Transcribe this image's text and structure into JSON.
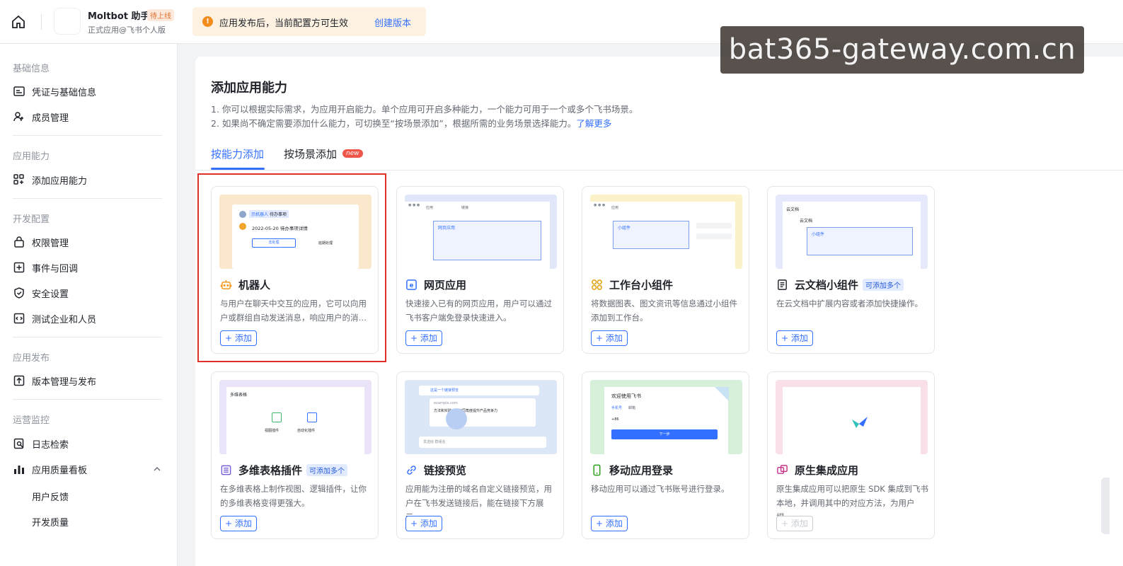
{
  "header": {
    "app_name": "Moltbot 助手",
    "app_status": "待上线",
    "app_subtitle": "正式应用@飞书个人版",
    "notice_text": "应用发布后，当前配置方可生效",
    "notice_link": "创建版本",
    "notice_icon": "!"
  },
  "watermark": "bat365-gateway.com.cn",
  "sidebar": {
    "sections": [
      {
        "title": "基础信息",
        "items": [
          "凭证与基础信息",
          "成员管理"
        ]
      },
      {
        "title": "应用能力",
        "items": [
          "添加应用能力"
        ]
      },
      {
        "title": "开发配置",
        "items": [
          "权限管理",
          "事件与回调",
          "安全设置",
          "测试企业和人员"
        ]
      },
      {
        "title": "应用发布",
        "items": [
          "版本管理与发布"
        ]
      },
      {
        "title": "运营监控",
        "items": [
          "日志检索",
          "应用质量看板"
        ],
        "subitems": [
          "用户反馈",
          "开发质量"
        ]
      }
    ]
  },
  "main": {
    "title": "添加应用能力",
    "desc1": "1. 你可以根据实际需求，为应用开启能力。单个应用可开启多种能力，一个能力可用于一个或多个飞书场景。",
    "desc2": "2. 如果尚不确定需要添加什么能力，可切换至“按场景添加”，根据所需的业务场景选择能力。",
    "desc2_link": "了解更多",
    "tabs": [
      {
        "label": "按能力添加",
        "active": true
      },
      {
        "label": "按场景添加",
        "badge": "new"
      }
    ],
    "add_label": "+ 添加",
    "multi_badge": "可添加多个",
    "cards": [
      {
        "title": "机器人",
        "desc": "与用户在聊天中交互的应用，它可以向用户或群组自动发送消息，响应用户的消…",
        "icon": "robot-icon",
        "disabled": false
      },
      {
        "title": "网页应用",
        "desc": "快速接入已有的网页应用，用户可以通过飞书客户端免登录快速进入。",
        "icon": "web-app-icon",
        "disabled": false
      },
      {
        "title": "工作台小组件",
        "desc": "将数据图表、图文资讯等信息通过小组件添加到工作台。",
        "icon": "widget-icon",
        "disabled": false
      },
      {
        "title": "云文档小组件",
        "desc": "在云文档中扩展内容或者添加快捷操作。",
        "icon": "doc-icon",
        "multi": true,
        "disabled": false
      },
      {
        "title": "多维表格插件",
        "desc": "在多维表格上制作视图、逻辑插件，让你的多维表格变得更强大。",
        "icon": "base-icon",
        "multi": true,
        "disabled": false
      },
      {
        "title": "链接预览",
        "desc": "应用能为注册的域名自定义链接预览，用户在飞书发送链接后，能在链接下方展示…",
        "icon": "link-icon",
        "disabled": false
      },
      {
        "title": "移动应用登录",
        "desc": "移动应用可以通过飞书账号进行登录。",
        "icon": "mobile-icon",
        "disabled": false
      },
      {
        "title": "原生集成应用",
        "desc": "原生集成应用可以把原生 SDK 集成到飞书本地，并调用其中的对应方法，为用户提…",
        "icon": "native-icon",
        "disabled": true
      }
    ],
    "thumbs": {
      "bot_tag": "示机器人",
      "bot_tag2": "待办事项",
      "bot_date": "2022-05-20 待办事项详情",
      "bot_btn": "去处理",
      "bot_btn2": "延期处理",
      "web_tab1": "应用",
      "web_tab2": "链接",
      "web_box": "网页应用",
      "widget_tab": "应用",
      "widget_box": "小组件",
      "doc_back": "云文档",
      "doc_head": "云文档",
      "doc_box": "小组件",
      "base_title": "多维表格",
      "base_plugin1": "视图插件",
      "base_plugin2": "自动化插件",
      "link_text": "这是一个链接预览",
      "link_url": "example.com",
      "link_card": "方法和实践，从不同角度提升产品竞争力",
      "link_input": "发送给 群组名",
      "login_title": "欢迎使用飞书",
      "login_tab1": "手机号",
      "login_tab2": "邮箱",
      "login_code": "+86",
      "login_btn": "下一步"
    }
  }
}
